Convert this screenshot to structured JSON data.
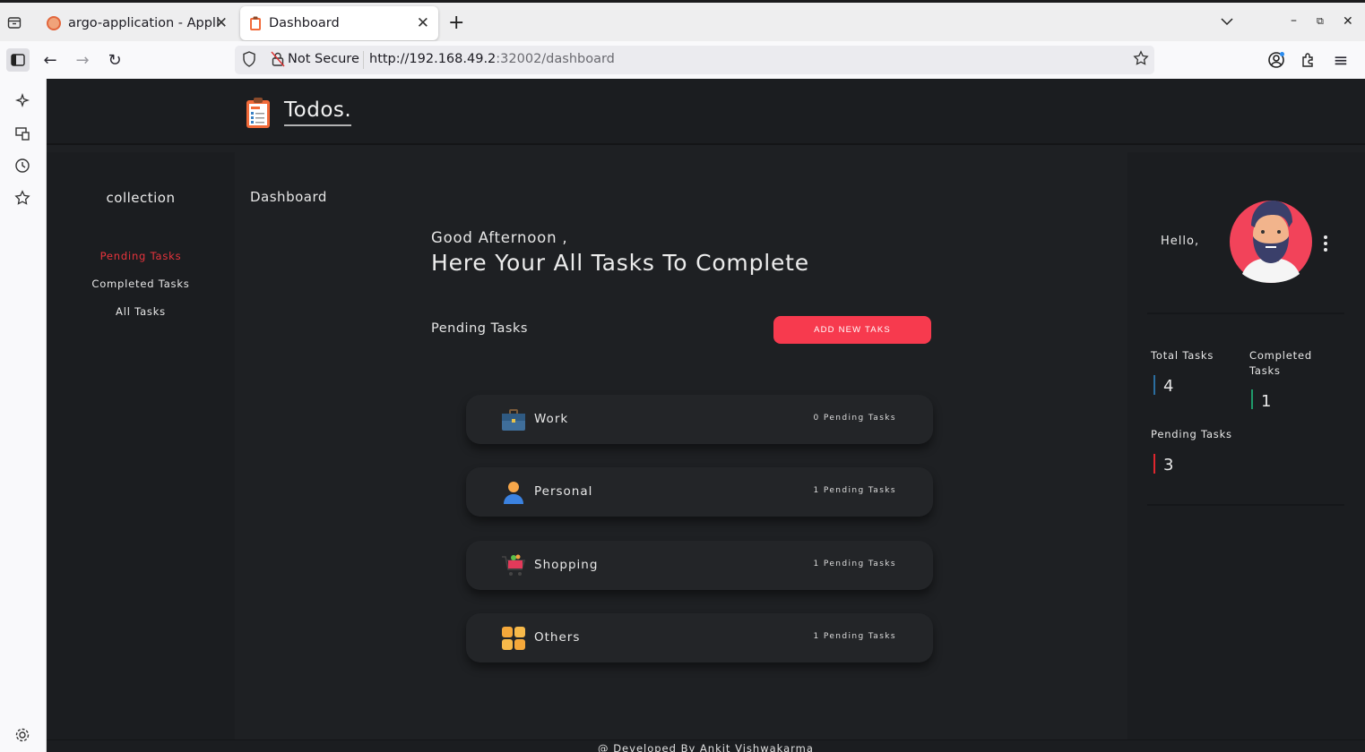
{
  "browser": {
    "tabs": [
      {
        "title": "argo-application - Application Details",
        "active": false
      },
      {
        "title": "Dashboard",
        "active": true
      }
    ],
    "url_security": "Not Secure",
    "url_host": "http://192.168.49.2",
    "url_rest": ":32002/dashboard",
    "icons": {
      "tab_list": "tab-list-icon",
      "new_tab": "+",
      "back": "←",
      "forward": "→",
      "reload": "↻",
      "menu": "≡"
    }
  },
  "app": {
    "logo_text": "Todos.",
    "colors": {
      "accent": "#f73a4e",
      "active_link": "#e8343c",
      "total_bar": "#2b6ea0",
      "completed_bar": "#1f9a6a",
      "pending_bar": "#e0262e"
    }
  },
  "left_nav": {
    "title": "collection",
    "items": [
      {
        "label": "Pending Tasks",
        "active": true
      },
      {
        "label": "Completed Tasks",
        "active": false
      },
      {
        "label": "All Tasks",
        "active": false
      }
    ]
  },
  "main": {
    "breadcrumb": "Dashboard",
    "greeting": "Good Afternoon ,",
    "headline": "Here Your All Tasks To Complete",
    "section_title": "Pending Tasks",
    "add_button": "ADD NEW TAKS",
    "categories": [
      {
        "name": "Work",
        "count": "0 Pending Tasks",
        "icon": "briefcase-icon"
      },
      {
        "name": "Personal",
        "count": "1 Pending Tasks",
        "icon": "person-icon"
      },
      {
        "name": "Shopping",
        "count": "1 Pending Tasks",
        "icon": "shopping-cart-icon"
      },
      {
        "name": "Others",
        "count": "1 Pending Tasks",
        "icon": "grid-icon"
      }
    ]
  },
  "profile": {
    "hello": "Hello,",
    "stats": {
      "total_label": "Total Tasks",
      "total_value": "4",
      "completed_label": "Completed Tasks",
      "completed_value": "1",
      "pending_label": "Pending Tasks",
      "pending_value": "3"
    }
  },
  "footer": {
    "text": "@ Developed By Ankit Vishwakarma"
  }
}
